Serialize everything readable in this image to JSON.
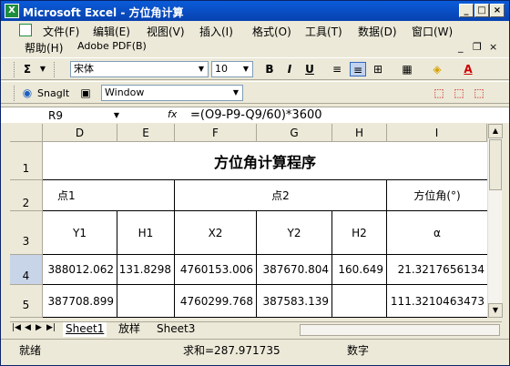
{
  "window": {
    "title": "Microsoft Excel - 方位角计算",
    "app_icon": "X"
  },
  "menu": [
    "文件(F)",
    "编辑(E)",
    "视图(V)",
    "插入(I)",
    "格式(O)",
    "工具(T)",
    "数据(D)",
    "窗口(W)",
    "帮助(H)",
    "Adobe PDF(B)"
  ],
  "window_controls": {
    "min": "_",
    "max": "□",
    "close": "×"
  },
  "doc_controls": {
    "min": "_",
    "restore": "❐",
    "close": "×"
  },
  "toolbar": {
    "sum": "Σ",
    "font": "宋体",
    "size": "10",
    "bold": "B",
    "italic": "I",
    "underline": "U",
    "font_color": "A",
    "snagit": "SnagIt",
    "window_combo": "Window"
  },
  "formula_bar": {
    "name_box": "R9",
    "fx": "fx",
    "formula": "=(O9-P9-Q9/60)*3600"
  },
  "columns": [
    "D",
    "E",
    "F",
    "G",
    "H",
    "I"
  ],
  "rows": [
    "1",
    "2",
    "3",
    "4",
    "5"
  ],
  "sheet": {
    "title": "方位角计算程序",
    "point1": "点1",
    "point2": "点2",
    "azimuth_header": "方位角(°)",
    "headers": {
      "y1": "Y1",
      "h1": "H1",
      "x2": "X2",
      "y2": "Y2",
      "h2": "H2",
      "alpha": "α"
    },
    "row4": {
      "d": "388012.062",
      "e": "131.8298",
      "f": "4760153.006",
      "g": "387670.804",
      "h": "160.649",
      "i": "21.3217656134"
    },
    "row5": {
      "d": "387708.899",
      "e": "",
      "f": "4760299.768",
      "g": "387583.139",
      "h": "",
      "i": "111.3210463473"
    }
  },
  "tabs": [
    "Sheet1",
    "放样",
    "Sheet3"
  ],
  "status": {
    "ready": "就绪",
    "sum": "求和=287.971735",
    "mode": "数字"
  }
}
